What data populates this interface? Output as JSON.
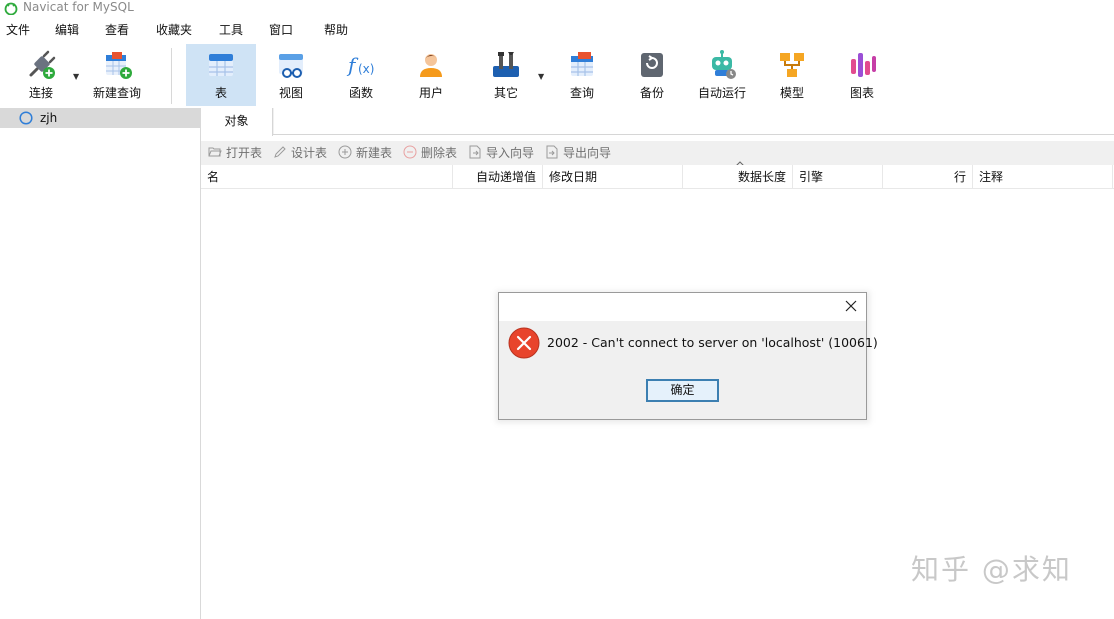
{
  "window": {
    "title": "Navicat for MySQL"
  },
  "menu": [
    "文件",
    "编辑",
    "查看",
    "收藏夹",
    "工具",
    "窗口",
    "帮助"
  ],
  "toolbar": {
    "connect": "连接",
    "new_query": "新建查询",
    "table": "表",
    "view": "视图",
    "function": "函数",
    "user": "用户",
    "other": "其它",
    "query": "查询",
    "backup": "备份",
    "auto_run": "自动运行",
    "model": "模型",
    "chart": "图表"
  },
  "sidebar": {
    "connection_name": "zjh"
  },
  "tabs": {
    "objects": "对象"
  },
  "object_toolbar": {
    "open_table": "打开表",
    "design_table": "设计表",
    "new_table": "新建表",
    "delete_table": "删除表",
    "import_wizard": "导入向导",
    "export_wizard": "导出向导"
  },
  "grid": {
    "columns": {
      "name": "名",
      "auto_increment": "自动递增值",
      "modified_date": "修改日期",
      "data_length": "数据长度",
      "engine": "引擎",
      "rows": "行",
      "comment": "注释"
    }
  },
  "dialog": {
    "message": "2002 - Can't connect to server on 'localhost' (10061)",
    "ok_label": "确定"
  },
  "watermark": "知乎 @求知",
  "colors": {
    "active_tab": "#cfe3f5",
    "error_red": "#e8442c",
    "ok_border": "#3c7fb1"
  }
}
